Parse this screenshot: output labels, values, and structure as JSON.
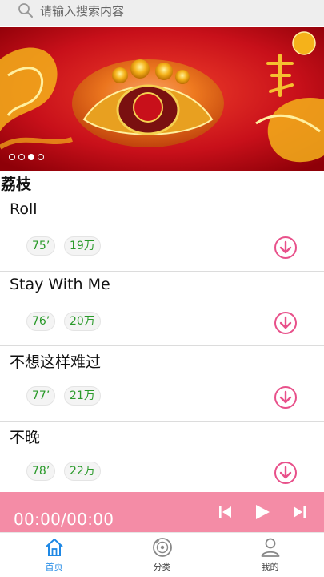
{
  "search": {
    "placeholder": "请输入搜索内容"
  },
  "banner": {
    "slide_count": 4,
    "active_slide": 3
  },
  "section": {
    "title": "荔枝"
  },
  "songs": [
    {
      "title": "Roll",
      "score": "75’",
      "plays": "19万"
    },
    {
      "title": "Stay With Me",
      "score": "76’",
      "plays": "20万"
    },
    {
      "title": "不想这样难过",
      "score": "77’",
      "plays": "21万"
    },
    {
      "title": "不晚",
      "score": "78’",
      "plays": "22万"
    }
  ],
  "player": {
    "time": "00:00/00:00"
  },
  "tabs": [
    {
      "label": "首页",
      "icon": "home-icon",
      "active": true
    },
    {
      "label": "分类",
      "icon": "disc-icon",
      "active": false
    },
    {
      "label": "我的",
      "icon": "user-icon",
      "active": false
    }
  ],
  "colors": {
    "accent_pink": "#f48ca6",
    "download_pink": "#e8508a",
    "chip_green": "#2a9a2a",
    "tab_active": "#1e88e5"
  }
}
